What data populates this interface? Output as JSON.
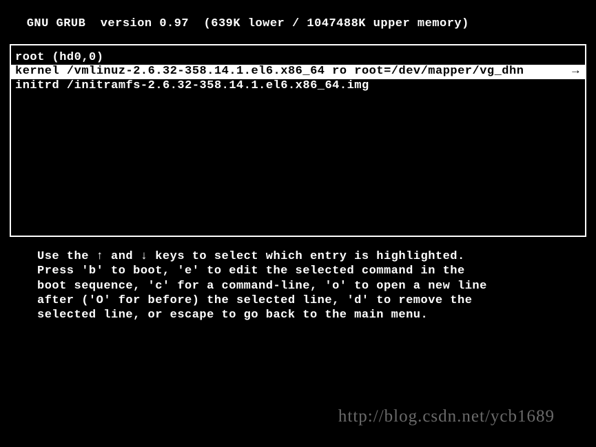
{
  "header": {
    "text": " GNU GRUB  version 0.97  (639K lower / 1047488K upper memory)"
  },
  "menu": {
    "items": [
      {
        "text": "root (hd0,0)",
        "selected": false
      },
      {
        "text": "kernel /vmlinuz-2.6.32-358.14.1.el6.x86_64 ro root=/dev/mapper/vg_dhn",
        "arrow": "→",
        "selected": true
      },
      {
        "text": "initrd /initramfs-2.6.32-358.14.1.el6.x86_64.img",
        "selected": false
      }
    ]
  },
  "help": {
    "line1": "Use the ↑ and ↓ keys to select which entry is highlighted.",
    "line2": "Press 'b' to boot, 'e' to edit the selected command in the",
    "line3": "boot sequence, 'c' for a command-line, 'o' to open a new line",
    "line4": "after ('O' for before) the selected line, 'd' to remove the",
    "line5": "selected line, or escape to go back to the main menu."
  },
  "watermark": {
    "text": "http://blog.csdn.net/ycb1689"
  }
}
